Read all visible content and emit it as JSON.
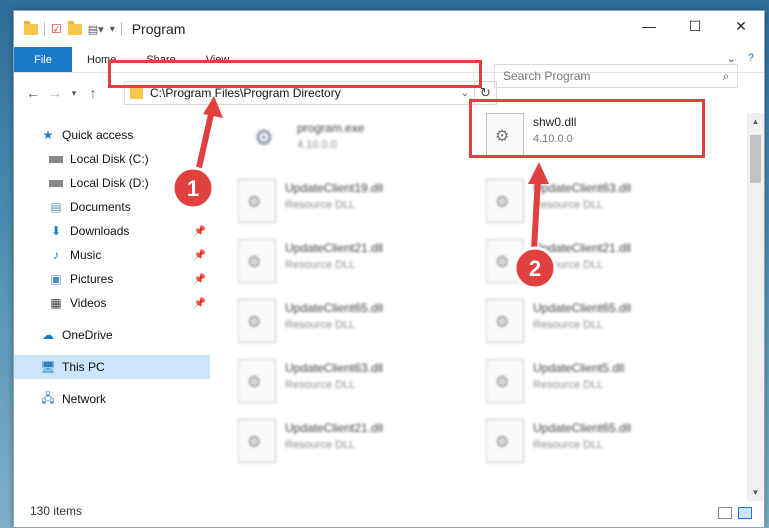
{
  "window": {
    "title": "Program"
  },
  "ribbon": {
    "file": "File",
    "home": "Home",
    "share": "Share",
    "view": "View"
  },
  "address": {
    "path": "C:\\Program Files\\Program Directory"
  },
  "search": {
    "placeholder": "Search Program"
  },
  "sidebar": {
    "items": [
      {
        "label": "Quick access",
        "icon": "star-icon"
      },
      {
        "label": "Local Disk (C:)",
        "icon": "drive-icon"
      },
      {
        "label": "Local Disk (D:)",
        "icon": "drive-icon"
      },
      {
        "label": "Documents",
        "icon": "documents-icon"
      },
      {
        "label": "Downloads",
        "icon": "download-icon"
      },
      {
        "label": "Music",
        "icon": "music-icon"
      },
      {
        "label": "Pictures",
        "icon": "pictures-icon"
      },
      {
        "label": "Videos",
        "icon": "videos-icon"
      },
      {
        "label": "OneDrive",
        "icon": "cloud-icon"
      },
      {
        "label": "This PC",
        "icon": "computer-icon"
      },
      {
        "label": "Network",
        "icon": "network-icon"
      }
    ]
  },
  "files": {
    "highlighted": {
      "name": "shw0.dll",
      "sub": "4.10.0.0"
    },
    "program": {
      "name": "program.exe",
      "sub": "4.10.0.0"
    },
    "left": [
      {
        "name": "UpdateClient19.dll",
        "sub": "Resource DLL"
      },
      {
        "name": "UpdateClient21.dll",
        "sub": "Resource DLL"
      },
      {
        "name": "UpdateClient65.dll",
        "sub": "Resource DLL"
      },
      {
        "name": "UpdateClient63.dll",
        "sub": "Resource DLL"
      },
      {
        "name": "UpdateClient21.dll",
        "sub": "Resource DLL"
      }
    ],
    "right": [
      {
        "name": "UpdateClient63.dll",
        "sub": "Resource DLL"
      },
      {
        "name": "UpdateClient21.dll",
        "sub": "Resource DLL"
      },
      {
        "name": "UpdateClient65.dll",
        "sub": "Resource DLL"
      },
      {
        "name": "UpdateClient5.dll",
        "sub": "Resource DLL"
      },
      {
        "name": "UpdateClient65.dll",
        "sub": "Resource DLL"
      }
    ]
  },
  "status": {
    "items": "130 items"
  },
  "annotations": {
    "badge1": "1",
    "badge2": "2",
    "color": "#e0413f"
  }
}
